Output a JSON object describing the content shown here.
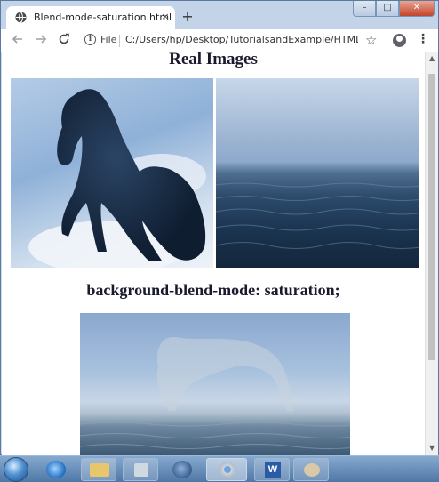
{
  "browser": {
    "tab_title": "Blend-mode-saturation.html",
    "tab_close": "×",
    "new_tab": "+",
    "file_label": "File",
    "url": "C:/Users/hp/Desktop/TutorialsandExample/HTML/Ble...",
    "menu_glyph": "⋮"
  },
  "page": {
    "heading_real": "Real Images",
    "heading_blend": "background-blend-mode: saturation;"
  },
  "icons": {
    "back": "arrow-left-icon",
    "forward": "arrow-right-icon",
    "reload": "reload-icon",
    "info": "info-icon",
    "star": "star-icon",
    "account": "account-icon",
    "menu": "kebab-menu-icon"
  },
  "taskbar": {
    "items": [
      "start-orb",
      "internet-explorer",
      "file-explorer",
      "media-player",
      "firefox",
      "chrome",
      "word",
      "paint"
    ]
  },
  "colors": {
    "taskbar": "#5f86b4",
    "heading": "#1a1a2e"
  }
}
